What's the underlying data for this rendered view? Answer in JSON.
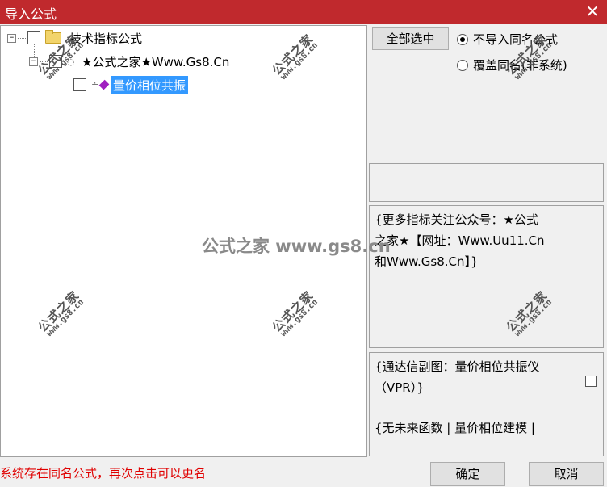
{
  "window": {
    "title": "导入公式",
    "close_glyph": "✕"
  },
  "tree": {
    "root": {
      "expander": "−",
      "label": "技术指标公式"
    },
    "group": {
      "expander": "−",
      "label": "★公式之家★Www.Gs8.Cn"
    },
    "item": {
      "label": "量价相位共振"
    }
  },
  "options": {
    "select_all_label": "全部选中",
    "radio_skip_label": "不导入同名公式",
    "radio_skip_selected": true,
    "radio_overwrite_label": "覆盖同名(非系统)",
    "radio_overwrite_selected": false
  },
  "description": {
    "line1": "{更多指标关注公众号：★公式",
    "line2": "之家★【网址：Www.Uu11.Cn",
    "line3": "和Www.Gs8.Cn】}"
  },
  "details": {
    "line1": "{通达信副图：量价相位共振仪",
    "line2": "（VPR）}",
    "line3": "{无未来函数 | 量价相位建模 |"
  },
  "status_message": "系统存在同名公式，再次点击可以更名",
  "buttons": {
    "ok": "确定",
    "cancel": "取消"
  },
  "watermarks": {
    "cn": "公式之家",
    "url": "www.gs8.cn",
    "center": "公式之家 www.gs8.cn"
  }
}
